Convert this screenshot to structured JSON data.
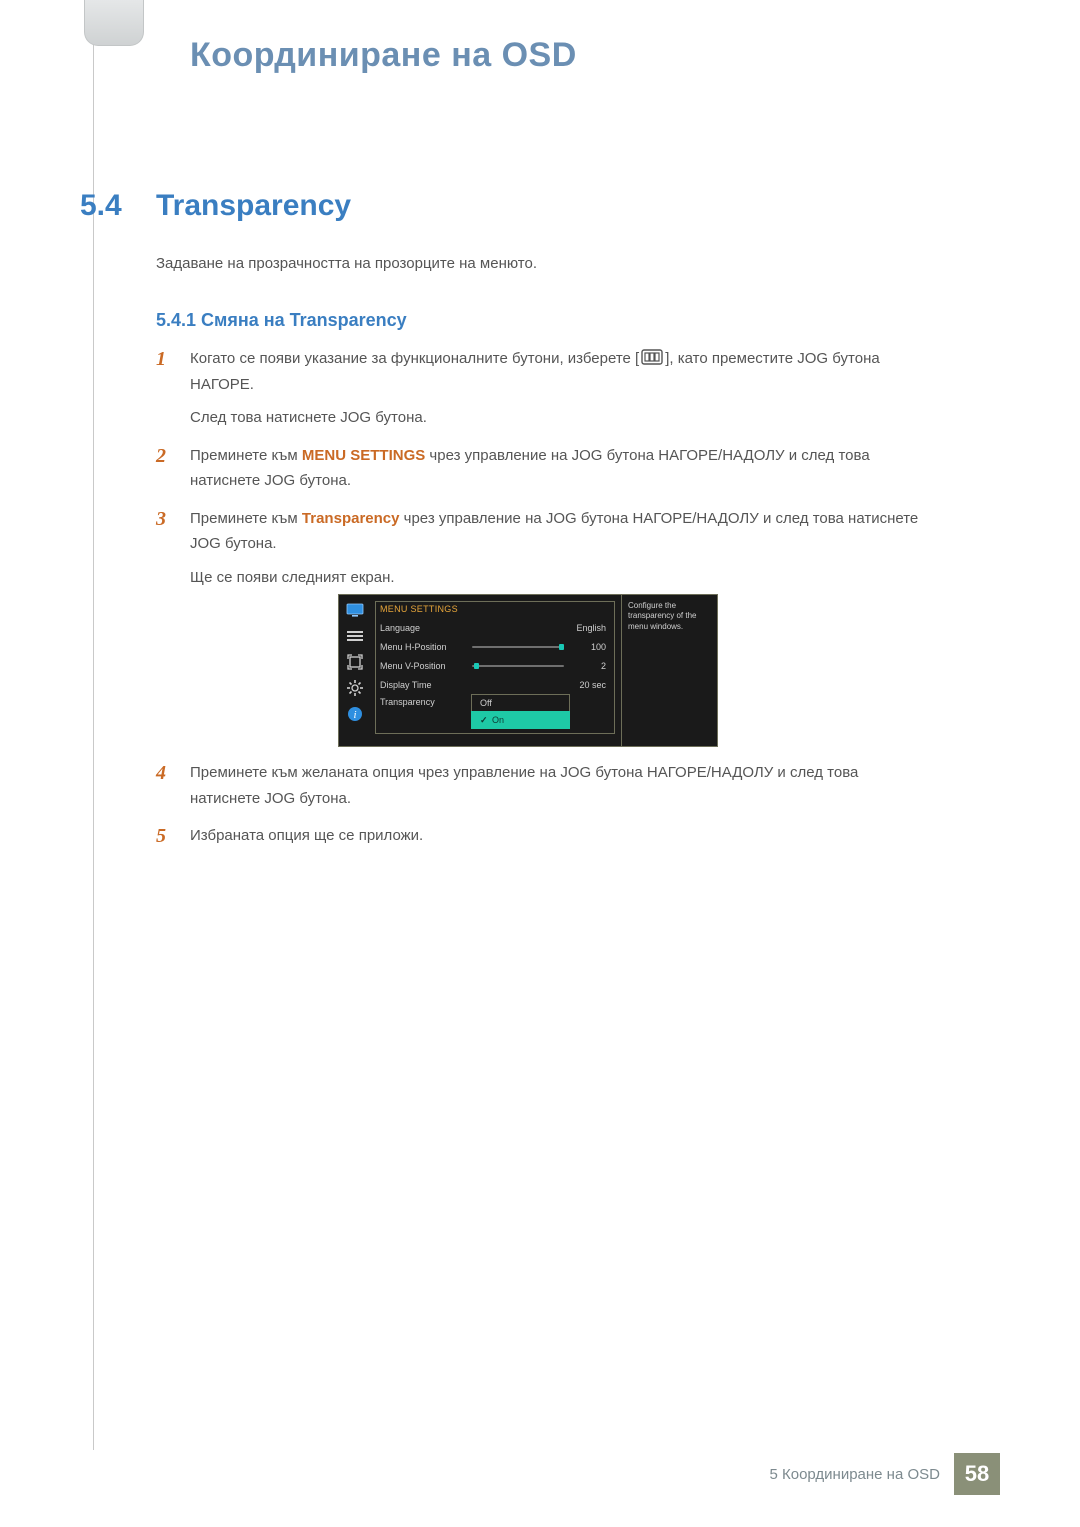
{
  "chapter_title": "Координиране на OSD",
  "section_num": "5.4",
  "section_title": "Transparency",
  "intro": "Задаване на прозрачността на прозорците на менюто.",
  "subsection": "5.4.1   Смяна на Transparency",
  "steps_a": [
    {
      "n": "1",
      "pre": "Когато се появи указание за функционалните бутони, изберете [",
      "post": "], като преместите JOG бутона НАГОРЕ.",
      "sub": "След това натиснете JOG бутона."
    },
    {
      "n": "2",
      "pre": "Преминете към ",
      "bold": "MENU SETTINGS",
      "post": " чрез управление на JOG бутона НАГОРЕ/НАДОЛУ и след това натиснете JOG бутона."
    },
    {
      "n": "3",
      "pre": "Преминете към ",
      "bold": "Transparency",
      "post": " чрез управление на JOG бутона НАГОРЕ/НАДОЛУ и след това натиснете JOG бутона.",
      "sub": "Ще се появи следният екран."
    }
  ],
  "steps_b": [
    {
      "n": "4",
      "text": "Преминете към желаната опция чрез управление на JOG бутона НАГОРЕ/НАДОЛУ и след това натиснете JOG бутона."
    },
    {
      "n": "5",
      "text": "Избраната опция ще се приложи."
    }
  ],
  "osd": {
    "title": "MENU SETTINGS",
    "rows": {
      "language": {
        "label": "Language",
        "value": "English"
      },
      "hpos": {
        "label": "Menu H-Position",
        "value": "100",
        "pct": 100
      },
      "vpos": {
        "label": "Menu V-Position",
        "value": "2",
        "pct": 2
      },
      "display_time": {
        "label": "Display Time",
        "value": "20 sec"
      },
      "transparency": {
        "label": "Transparency",
        "option_off": "Off",
        "option_on": "On"
      }
    },
    "help": "Configure the transparency of the menu windows."
  },
  "footer": {
    "text": "5 Координиране на OSD",
    "page": "58"
  }
}
